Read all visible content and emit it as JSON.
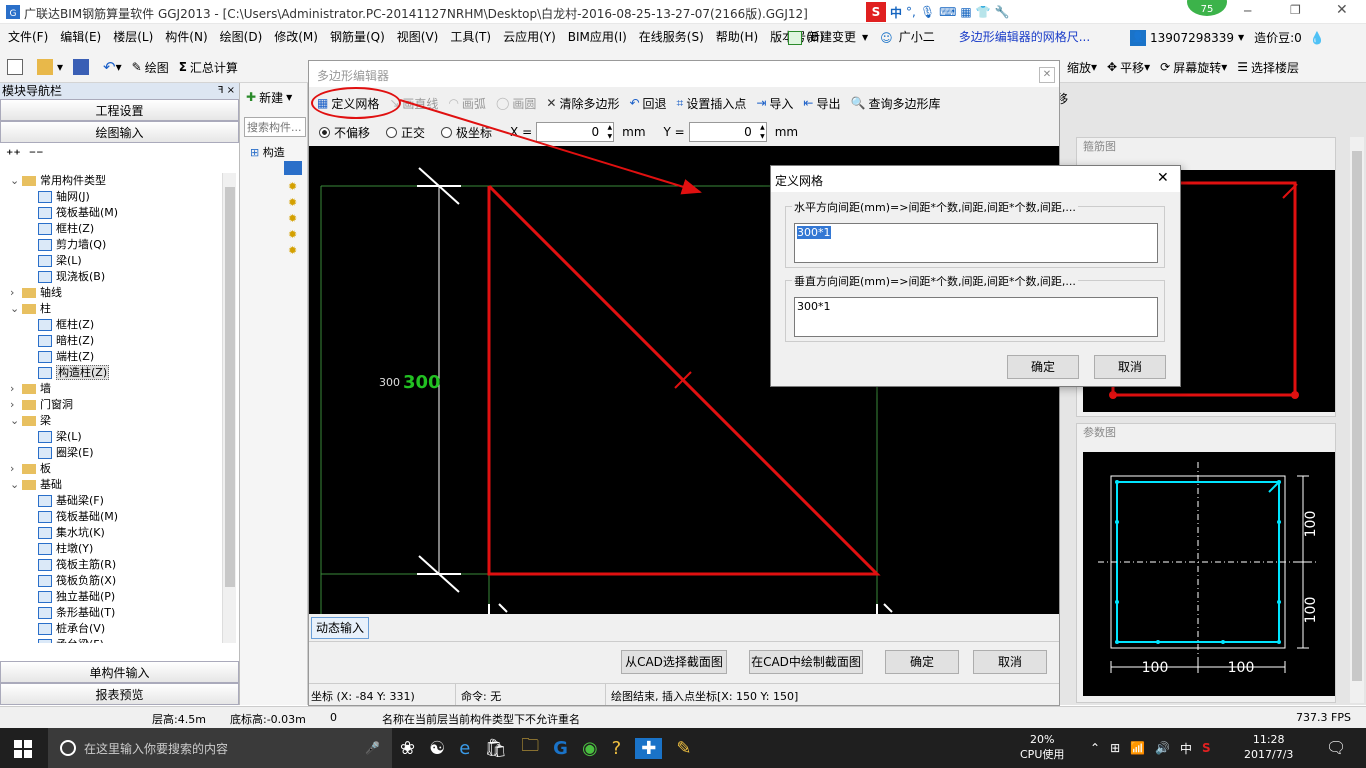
{
  "window": {
    "title": "广联达BIM钢筋算量软件 GGJ2013 - [C:\\Users\\Administrator.PC-20141127NRHM\\Desktop\\白龙村-2016-08-25-13-27-07(2166版).GGJ12]",
    "badge": "75"
  },
  "menu": [
    "文件(F)",
    "编辑(E)",
    "楼层(L)",
    "构件(N)",
    "绘图(D)",
    "修改(M)",
    "钢筋量(Q)",
    "视图(V)",
    "工具(T)",
    "云应用(Y)",
    "BIM应用(I)",
    "在线服务(S)",
    "帮助(H)",
    "版本号(B)"
  ],
  "menu_right": {
    "new_change": "新建变更",
    "assistant": "广小二",
    "hint": "多边形编辑器的网格尺...",
    "phone": "13907298339",
    "price": "造价豆:0"
  },
  "toolbar": {
    "draw": "绘图",
    "sum": "汇总计算",
    "zoom": "缩放",
    "pan": "平移",
    "rotate": "屏幕旋转",
    "select_floor": "选择楼层",
    "move_down": "下移",
    "move": "移"
  },
  "left": {
    "title": "模块导航栏",
    "pin": "ꟻ ×",
    "project_settings": "工程设置",
    "draw_input": "绘图输入",
    "single_input": "单构件输入",
    "report_preview": "报表预览",
    "tree": [
      {
        "t": "常用构件类型",
        "lv": 0,
        "folder": true
      },
      {
        "t": "轴网(J)",
        "lv": 1
      },
      {
        "t": "筏板基础(M)",
        "lv": 1
      },
      {
        "t": "框柱(Z)",
        "lv": 1
      },
      {
        "t": "剪力墙(Q)",
        "lv": 1
      },
      {
        "t": "梁(L)",
        "lv": 1
      },
      {
        "t": "现浇板(B)",
        "lv": 1
      },
      {
        "t": "轴线",
        "lv": 0,
        "folder": true
      },
      {
        "t": "柱",
        "lv": 0,
        "folder": true
      },
      {
        "t": "框柱(Z)",
        "lv": 1
      },
      {
        "t": "暗柱(Z)",
        "lv": 1
      },
      {
        "t": "端柱(Z)",
        "lv": 1
      },
      {
        "t": "构造柱(Z)",
        "lv": 1,
        "sel": true
      },
      {
        "t": "墙",
        "lv": 0,
        "folder": true
      },
      {
        "t": "门窗洞",
        "lv": 0,
        "folder": true
      },
      {
        "t": "梁",
        "lv": 0,
        "folder": true
      },
      {
        "t": "梁(L)",
        "lv": 1
      },
      {
        "t": "圈梁(E)",
        "lv": 1
      },
      {
        "t": "板",
        "lv": 0,
        "folder": true
      },
      {
        "t": "基础",
        "lv": 0,
        "folder": true
      },
      {
        "t": "基础梁(F)",
        "lv": 1
      },
      {
        "t": "筏板基础(M)",
        "lv": 1
      },
      {
        "t": "集水坑(K)",
        "lv": 1
      },
      {
        "t": "柱墩(Y)",
        "lv": 1
      },
      {
        "t": "筏板主筋(R)",
        "lv": 1
      },
      {
        "t": "筏板负筋(X)",
        "lv": 1
      },
      {
        "t": "独立基础(P)",
        "lv": 1
      },
      {
        "t": "条形基础(T)",
        "lv": 1
      },
      {
        "t": "桩承台(V)",
        "lv": 1
      },
      {
        "t": "承台梁(F)",
        "lv": 1
      }
    ]
  },
  "mid": {
    "new": "新建",
    "search_placeholder": "搜索构件...",
    "root": "构造"
  },
  "editor": {
    "title": "多边形编辑器",
    "tools": [
      "定义网格",
      "画直线",
      "画弧",
      "画圆",
      "清除多边形",
      "回退",
      "设置插入点",
      "导入",
      "导出",
      "查询多边形库"
    ],
    "radio": [
      "不偏移",
      "正交",
      "极坐标"
    ],
    "x_label": "X =",
    "x_value": "0",
    "y_label": "Y =",
    "y_value": "0",
    "unit": "mm",
    "dim_small": "300",
    "dim_big": "300",
    "dynamic_input": "动态输入",
    "btn_cad_select": "从CAD选择截面图",
    "btn_cad_draw": "在CAD中绘制截面图",
    "btn_ok": "确定",
    "btn_cancel": "取消",
    "status_coord": "坐标 (X: -84 Y: 331)",
    "status_cmd": "命令: 无",
    "status_msg": "绘图结束, 插入点坐标[X: 150 Y: 150]"
  },
  "grid_dialog": {
    "title": "定义网格",
    "h_label": "水平方向间距(mm)=>间距*个数,间距,间距*个数,间距,...",
    "h_value": "300*1",
    "v_label": "垂直方向间距(mm)=>间距*个数,间距,间距*个数,间距,...",
    "v_value": "300*1",
    "ok": "确定",
    "cancel": "取消"
  },
  "right": {
    "rebar_title": "箍筋图",
    "param_title": "参数图",
    "dim_v1": "100",
    "dim_v2": "100",
    "dim_h1": "100",
    "dim_h2": "100"
  },
  "status": {
    "floor_h": "层高:4.5m",
    "bottom_h": "底标高:-0.03m",
    "num": "0",
    "msg": "名称在当前层当前构件类型下不允许重名",
    "fps": "737.3 FPS"
  },
  "taskbar": {
    "search": "在这里输入你要搜索的内容",
    "cpu": "20%",
    "cpu_label": "CPU使用",
    "ime": "中",
    "time": "11:28",
    "date": "2017/7/3"
  },
  "colors": {
    "red": "#e01010",
    "cyan": "#00e5ff",
    "green": "#22c022"
  }
}
